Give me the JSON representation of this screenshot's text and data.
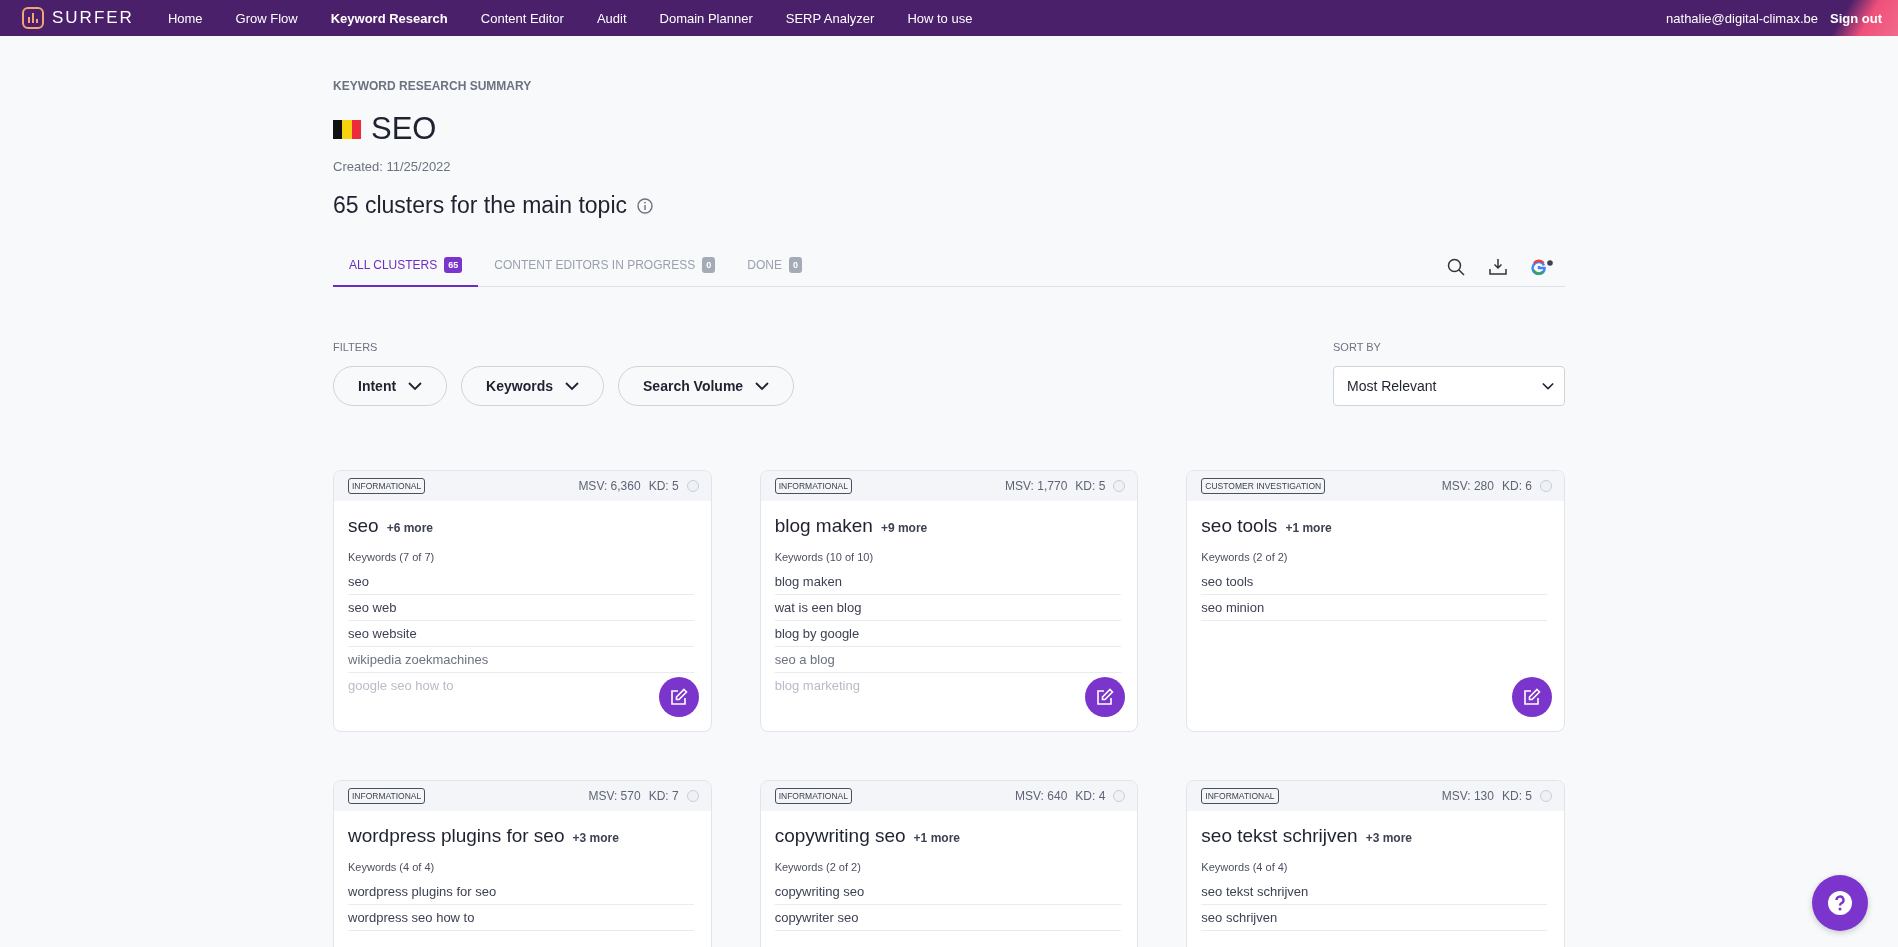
{
  "nav": {
    "logo": "SURFER",
    "items": [
      {
        "label": "Home",
        "selected": false
      },
      {
        "label": "Grow Flow",
        "selected": false
      },
      {
        "label": "Keyword Research",
        "selected": true
      },
      {
        "label": "Content Editor",
        "selected": false
      },
      {
        "label": "Audit",
        "selected": false
      },
      {
        "label": "Domain Planner",
        "selected": false
      },
      {
        "label": "SERP Analyzer",
        "selected": false
      },
      {
        "label": "How to use",
        "selected": false
      }
    ],
    "user": "nathalie@digital-climax.be",
    "sign_out": "Sign out"
  },
  "summary": {
    "eyebrow": "KEYWORD RESEARCH SUMMARY",
    "title": "SEO",
    "created": "Created: 11/25/2022",
    "heading": "65 clusters for the main topic"
  },
  "tabs": [
    {
      "label": "ALL CLUSTERS",
      "count": "65",
      "selected": true
    },
    {
      "label": "CONTENT EDITORS IN PROGRESS",
      "count": "0",
      "selected": false
    },
    {
      "label": "DONE",
      "count": "0",
      "selected": false
    }
  ],
  "filters": {
    "label": "FILTERS",
    "buttons": [
      "Intent",
      "Keywords",
      "Search Volume"
    ]
  },
  "sort": {
    "label": "SORT BY",
    "value": "Most Relevant"
  },
  "clusters": [
    {
      "intent": "INFORMATIONAL",
      "msv": "MSV: 6,360",
      "kd": "KD: 5",
      "title": "seo",
      "more": "+6 more",
      "keywords_label": "Keywords (7 of 7)",
      "keywords": [
        "seo",
        "seo web",
        "seo website",
        "wikipedia zoekmachines",
        "google seo how to"
      ]
    },
    {
      "intent": "INFORMATIONAL",
      "msv": "MSV: 1,770",
      "kd": "KD: 5",
      "title": "blog maken",
      "more": "+9 more",
      "keywords_label": "Keywords (10 of 10)",
      "keywords": [
        "blog maken",
        "wat is een blog",
        "blog by google",
        "seo a blog",
        "blog marketing"
      ]
    },
    {
      "intent": "CUSTOMER INVESTIGATION",
      "msv": "MSV: 280",
      "kd": "KD: 6",
      "title": "seo tools",
      "more": "+1 more",
      "keywords_label": "Keywords (2 of 2)",
      "keywords": [
        "seo tools",
        "seo minion"
      ]
    },
    {
      "intent": "INFORMATIONAL",
      "msv": "MSV: 570",
      "kd": "KD: 7",
      "title": "wordpress plugins for seo",
      "more": "+3 more",
      "keywords_label": "Keywords (4 of 4)",
      "keywords": [
        "wordpress plugins for seo",
        "wordpress seo how to"
      ]
    },
    {
      "intent": "INFORMATIONAL",
      "msv": "MSV: 640",
      "kd": "KD: 4",
      "title": "copywriting seo",
      "more": "+1 more",
      "keywords_label": "Keywords (2 of 2)",
      "keywords": [
        "copywriting seo",
        "copywriter seo"
      ]
    },
    {
      "intent": "INFORMATIONAL",
      "msv": "MSV: 130",
      "kd": "KD: 5",
      "title": "seo tekst schrijven",
      "more": "+3 more",
      "keywords_label": "Keywords (4 of 4)",
      "keywords": [
        "seo tekst schrijven",
        "seo schrijven"
      ]
    }
  ]
}
